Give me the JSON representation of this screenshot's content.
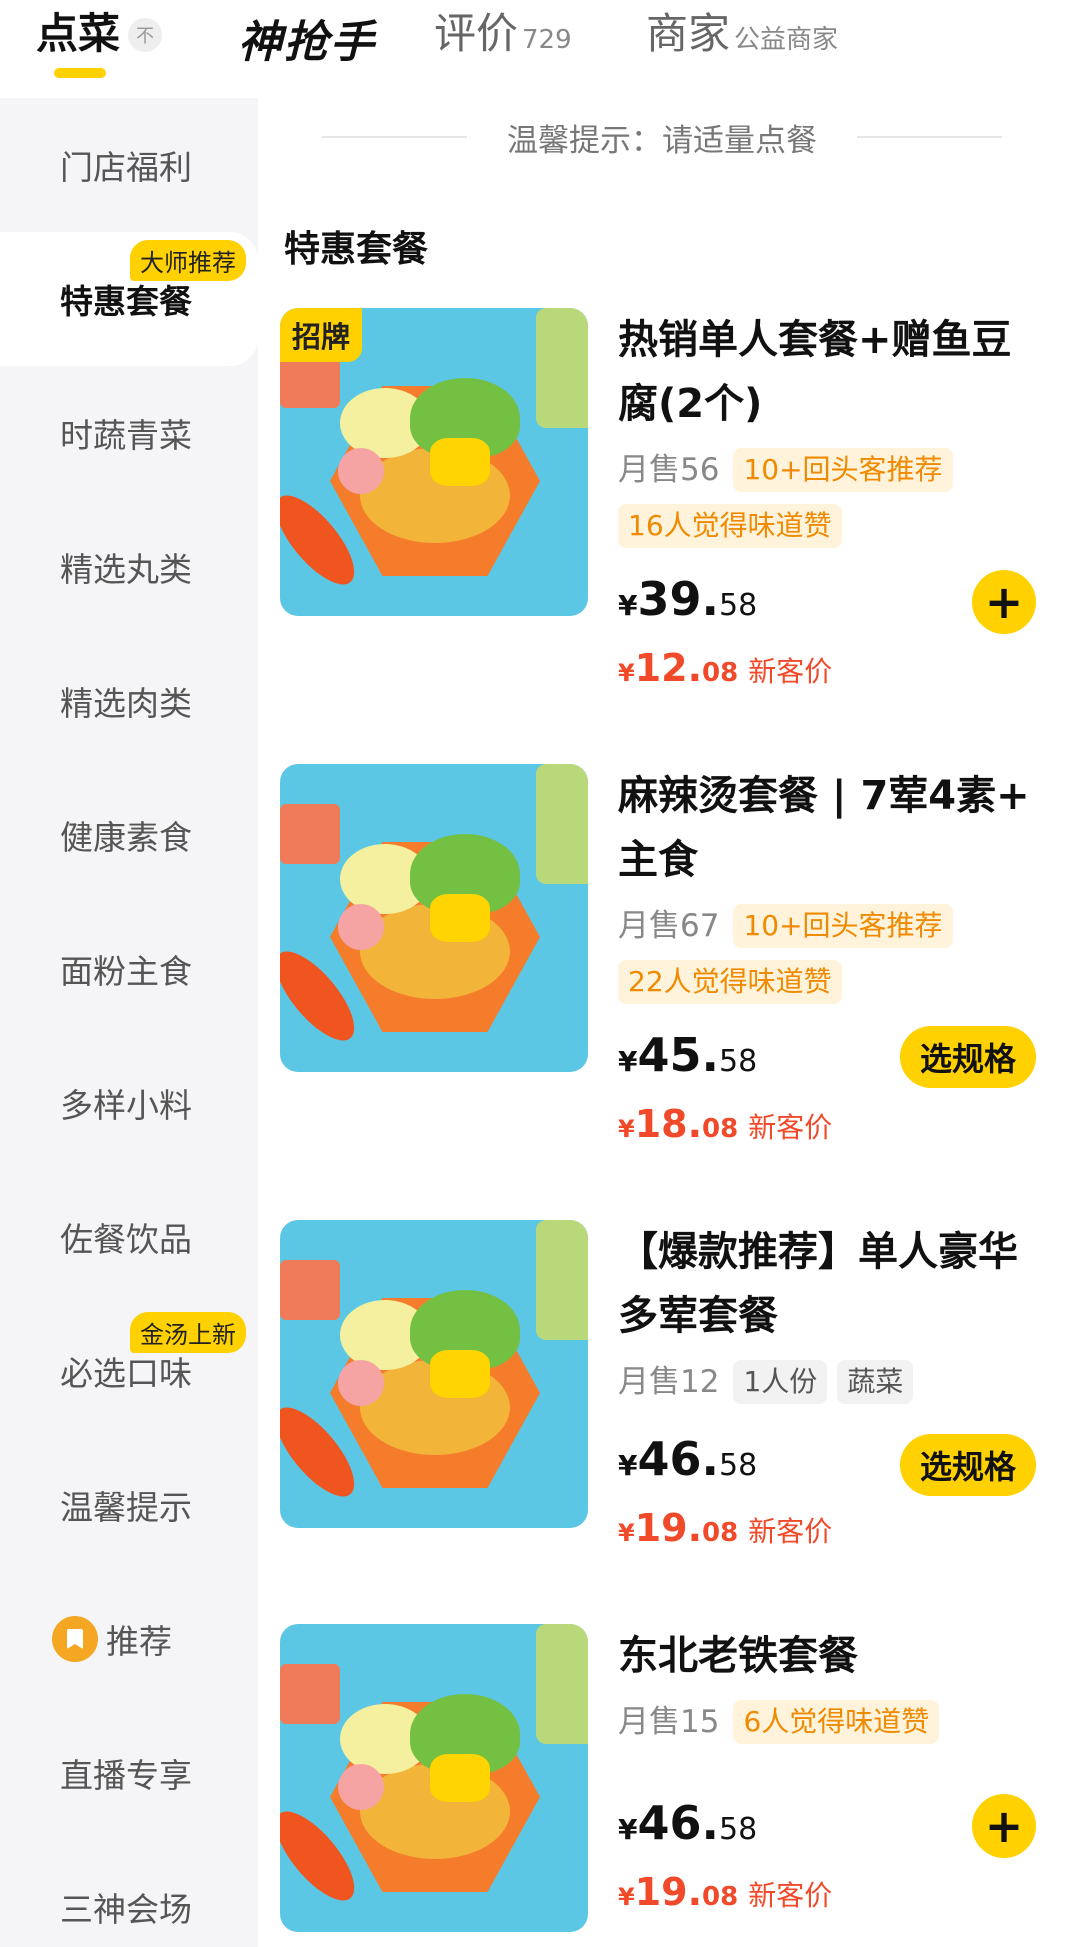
{
  "tabs": {
    "order": "点菜",
    "collapse_icon": "不",
    "brand": "神抢手",
    "reviews": "评价",
    "reviews_count": "729",
    "merchant": "商家",
    "merchant_sub": "公益商家"
  },
  "sidebar": {
    "items": [
      {
        "label": "门店福利"
      },
      {
        "label": "特惠套餐",
        "badge": "大师推荐"
      },
      {
        "label": "时蔬青菜"
      },
      {
        "label": "精选丸类"
      },
      {
        "label": "精选肉类"
      },
      {
        "label": "健康素食"
      },
      {
        "label": "面粉主食"
      },
      {
        "label": "多样小料"
      },
      {
        "label": "佐餐饮品"
      },
      {
        "label": "必选口味",
        "badge": "金汤上新"
      },
      {
        "label": "温馨提示"
      },
      {
        "label": "推荐"
      },
      {
        "label": "直播专享"
      },
      {
        "label": "三神会场"
      }
    ]
  },
  "tip": "温馨提示：请适量点餐",
  "section_title": "特惠套餐",
  "products": [
    {
      "badge": "招牌",
      "name": "热销单人套餐+赠鱼豆腐(2个)",
      "sales": "月售56",
      "tags": [
        "10+回头客推荐",
        "16人觉得味道赞"
      ],
      "yen": "¥",
      "price_int": "39.",
      "price_dec": "58",
      "new_price_int": "12.",
      "new_price_dec": "08",
      "new_label": "新客价",
      "action": "+"
    },
    {
      "name": "麻辣烫套餐 | 7荤4素+ 主食",
      "sales": "月售67",
      "tags": [
        "10+回头客推荐",
        "22人觉得味道赞"
      ],
      "yen": "¥",
      "price_int": "45.",
      "price_dec": "58",
      "new_price_int": "18.",
      "new_price_dec": "08",
      "new_label": "新客价",
      "action": "选规格"
    },
    {
      "name": "【爆款推荐】单人豪华多荤套餐",
      "sales": "月售12",
      "tags": [
        "1人份",
        "蔬菜"
      ],
      "yen": "¥",
      "price_int": "46.",
      "price_dec": "58",
      "new_price_int": "19.",
      "new_price_dec": "08",
      "new_label": "新客价",
      "action": "选规格"
    },
    {
      "name": "东北老铁套餐",
      "sales": "月售15",
      "tags": [
        "6人觉得味道赞"
      ],
      "yen": "¥",
      "price_int": "46.",
      "price_dec": "58",
      "new_price_int": "19.",
      "new_price_dec": "08",
      "new_label": "新客价",
      "action": "+"
    }
  ],
  "colors": {
    "accent_yellow": "#ffd100",
    "price_red": "#f04a2a",
    "tag_orange": "#f08a00",
    "sidebar_bg": "#f5f5f7"
  }
}
